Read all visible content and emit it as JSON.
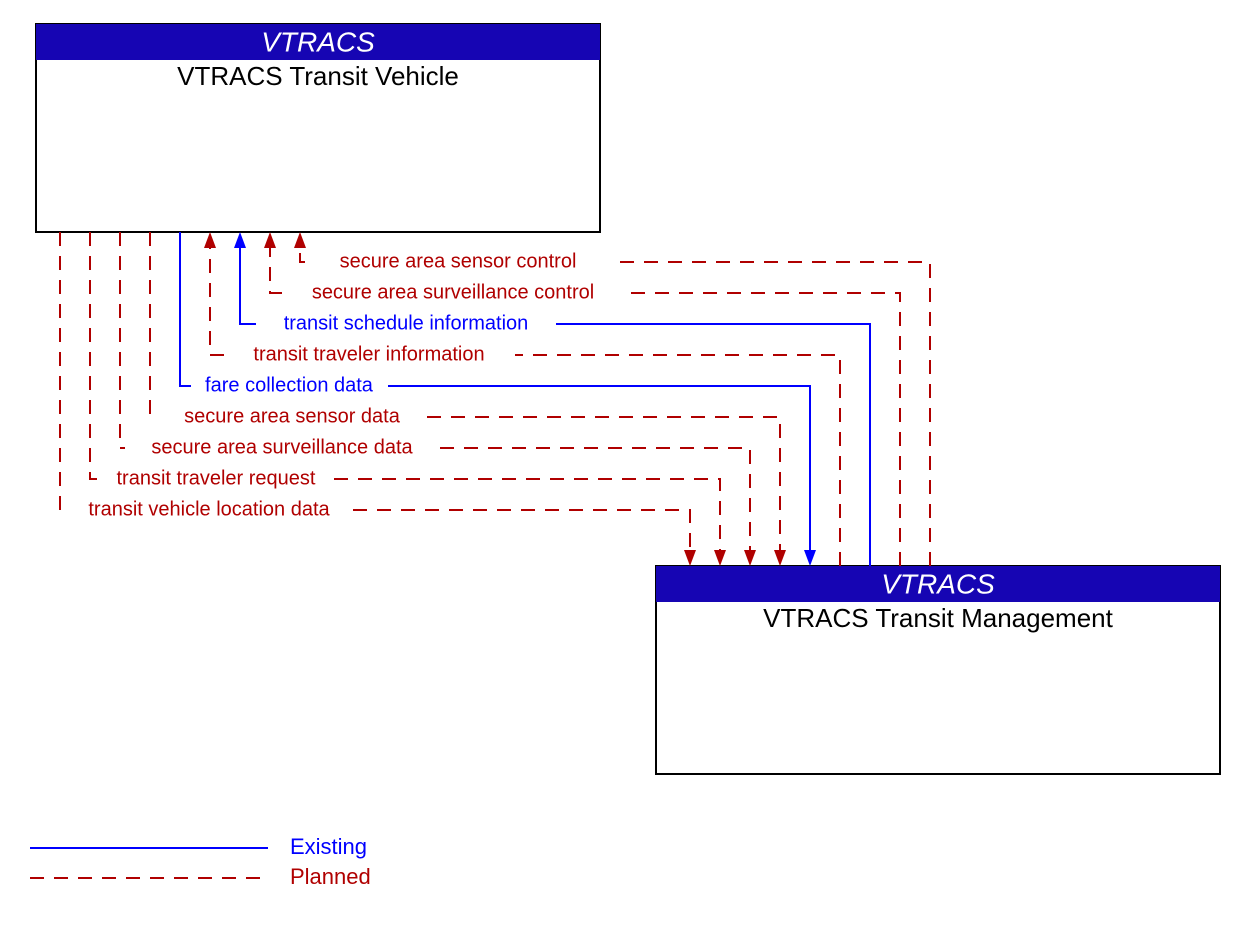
{
  "boxes": {
    "vehicle": {
      "header": "VTRACS",
      "title": "VTRACS Transit Vehicle"
    },
    "management": {
      "header": "VTRACS",
      "title": "VTRACS Transit Management"
    }
  },
  "flows": {
    "secure_area_sensor_control": {
      "label": "secure area sensor control",
      "style": "planned",
      "dir": "to_vehicle"
    },
    "secure_area_surveillance_control": {
      "label": "secure area surveillance control",
      "style": "planned",
      "dir": "to_vehicle"
    },
    "transit_schedule_information": {
      "label": "transit schedule information",
      "style": "existing",
      "dir": "to_vehicle"
    },
    "transit_traveler_information": {
      "label": "transit traveler information",
      "style": "planned",
      "dir": "to_vehicle"
    },
    "fare_collection_data": {
      "label": "fare collection data",
      "style": "existing",
      "dir": "to_management"
    },
    "secure_area_sensor_data": {
      "label": "secure area sensor data",
      "style": "planned",
      "dir": "to_management"
    },
    "secure_area_surveillance_data": {
      "label": "secure area surveillance data",
      "style": "planned",
      "dir": "to_management"
    },
    "transit_traveler_request": {
      "label": "transit traveler request",
      "style": "planned",
      "dir": "to_management"
    },
    "transit_vehicle_location_data": {
      "label": "transit vehicle location data",
      "style": "planned",
      "dir": "to_management"
    }
  },
  "legend": {
    "existing": "Existing",
    "planned": "Planned"
  },
  "colors": {
    "existing": "#0000ff",
    "planned": "#b00000",
    "header_bg": "#1605b3"
  }
}
